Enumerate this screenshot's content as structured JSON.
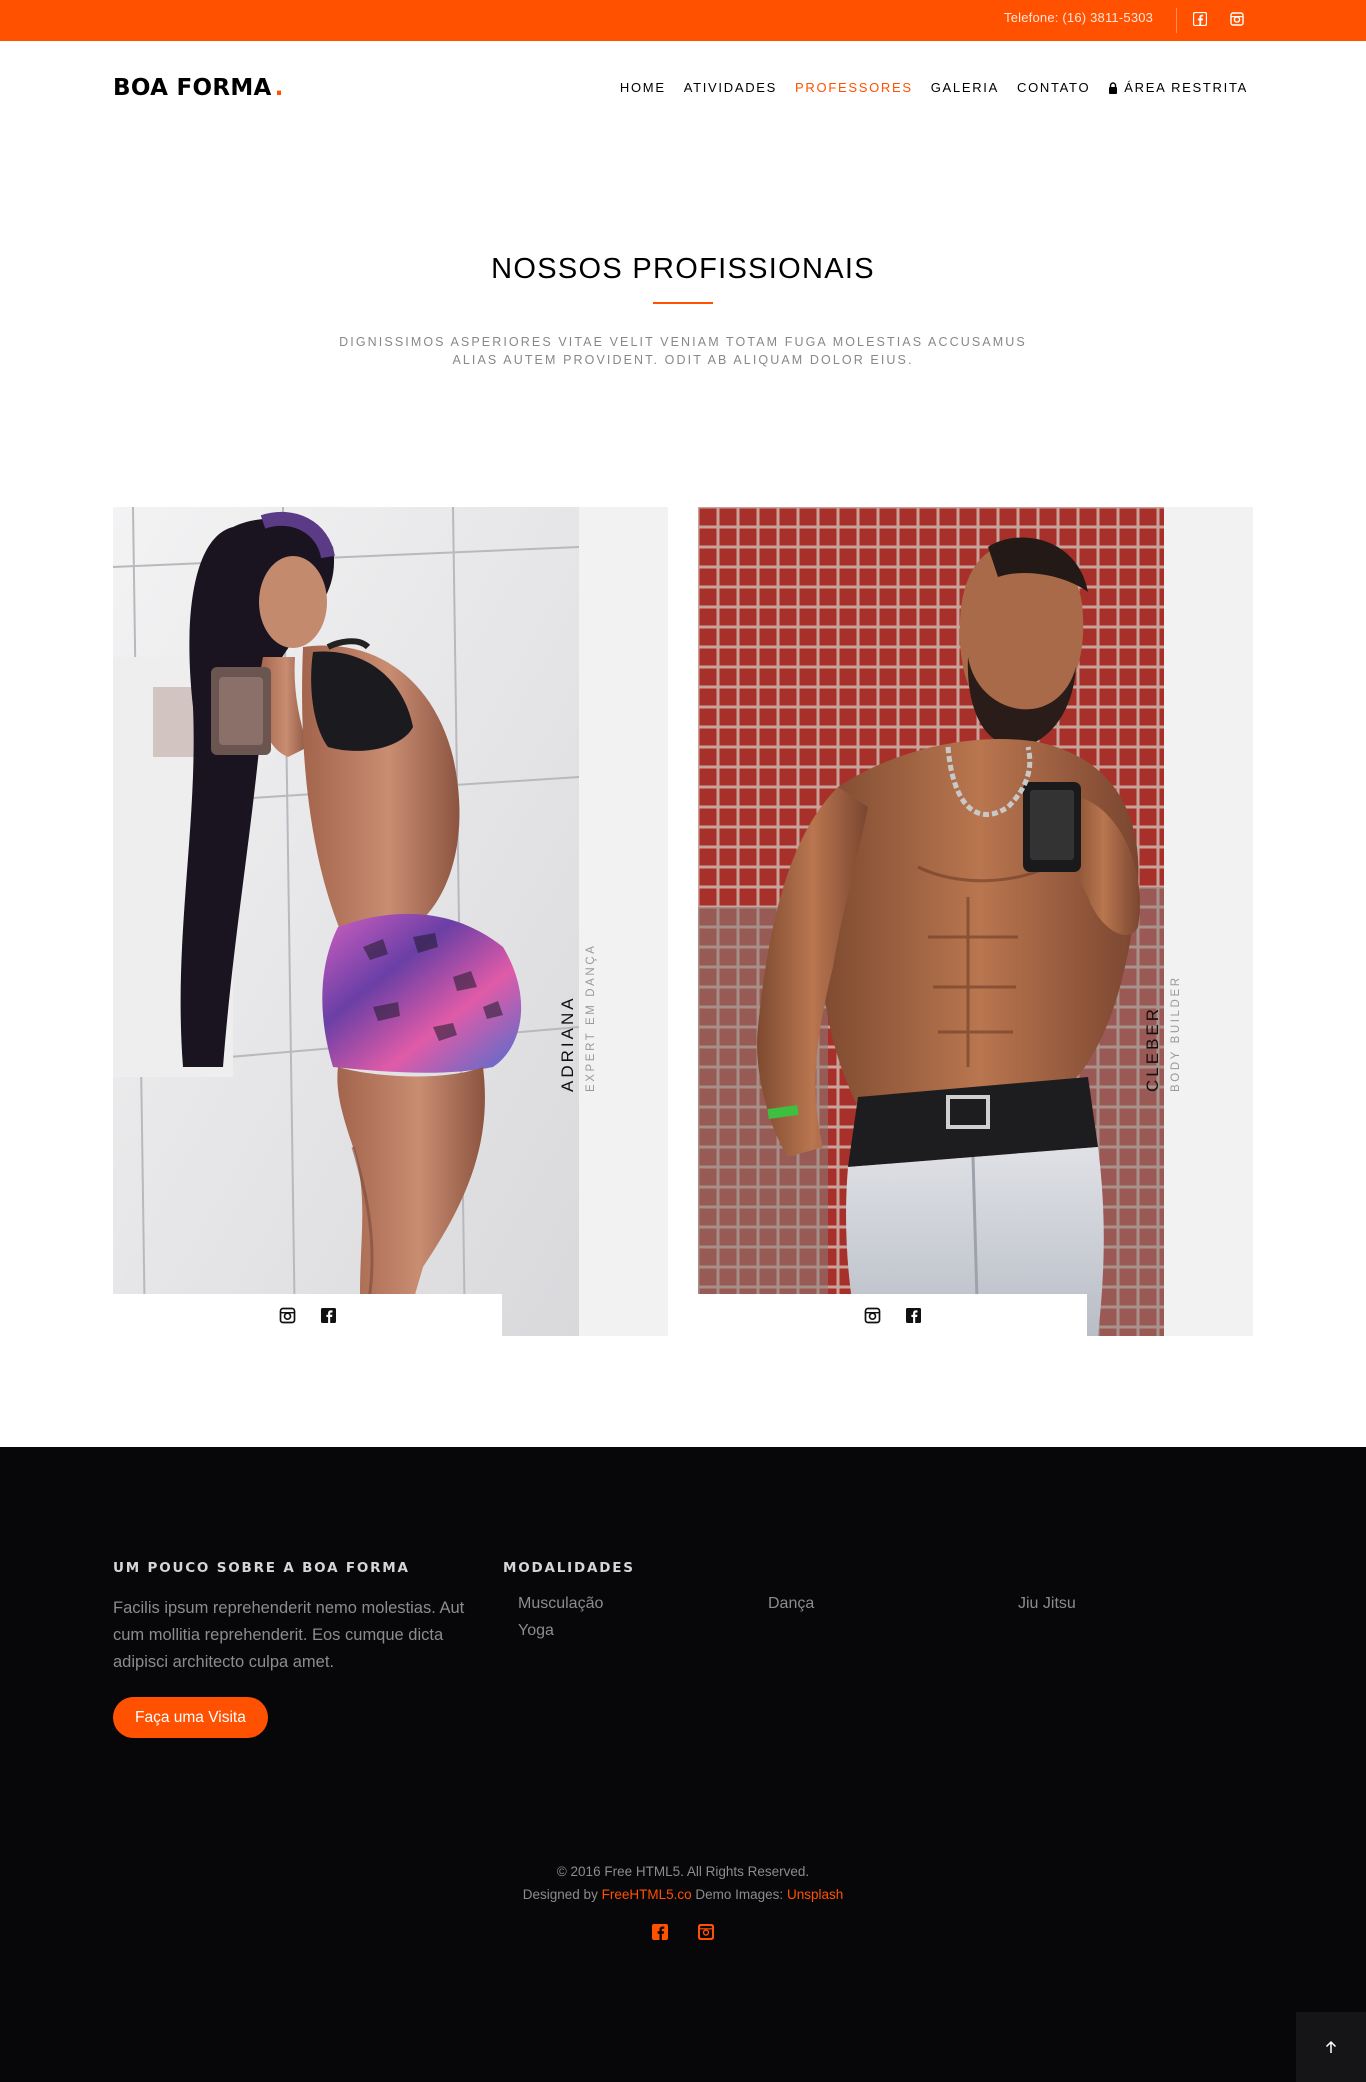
{
  "topbar": {
    "phone": "Telefone: (16) 3811-5303",
    "icons": [
      "facebook-icon",
      "instagram-icon"
    ],
    "bg_color": "#ff5100"
  },
  "header": {
    "logo_text": "BOA FORMA",
    "logo_dot": ".",
    "nav": [
      {
        "label": "HOME",
        "active": false
      },
      {
        "label": "ATIVIDADES",
        "active": false
      },
      {
        "label": "PROFESSORES",
        "active": true
      },
      {
        "label": "GALERIA",
        "active": false
      },
      {
        "label": "CONTATO",
        "active": false
      },
      {
        "label": "ÁREA RESTRITA",
        "active": false,
        "icon": "lock-icon"
      }
    ]
  },
  "section": {
    "title": "NOSSOS PROFISSIONAIS",
    "subtitle": "DIGNISSIMOS ASPERIORES VITAE VELIT VENIAM TOTAM FUGA MOLESTIAS ACCUSAMUS ALIAS AUTEM PROVIDENT. ODIT AB ALIQUAM DOLOR EIUS."
  },
  "trainers": [
    {
      "name": "ADRIANA",
      "role": "EXPERT EM DANÇA",
      "social": [
        "instagram-icon",
        "facebook-icon"
      ]
    },
    {
      "name": "CLEBER",
      "role": "BODY BUILDER",
      "social": [
        "instagram-icon",
        "facebook-icon"
      ]
    }
  ],
  "footer": {
    "about_heading": "UM POUCO SOBRE A BOA FORMA",
    "about_text": "Facilis ipsum reprehenderit nemo molestias. Aut cum mollitia reprehenderit. Eos cumque dicta adipisci architecto culpa amet.",
    "visit_button": "Faça uma Visita",
    "modalities_heading": "MODALIDADES",
    "modalities": [
      "Musculação",
      "Dança",
      "Jiu Jitsu",
      "Yoga"
    ],
    "copyright": "© 2016 Free HTML5. All Rights Reserved.",
    "designed_by": "Designed by",
    "designer": "FreeHTML5.co",
    "demo_images": "Demo Images:",
    "images_source": "Unsplash",
    "social": [
      "facebook-icon",
      "instagram-icon"
    ],
    "back_to_top": "arrow-up-icon"
  },
  "colors": {
    "accent": "#ff5100",
    "footer_bg": "#070709",
    "card_bg": "#f2f2f2"
  }
}
